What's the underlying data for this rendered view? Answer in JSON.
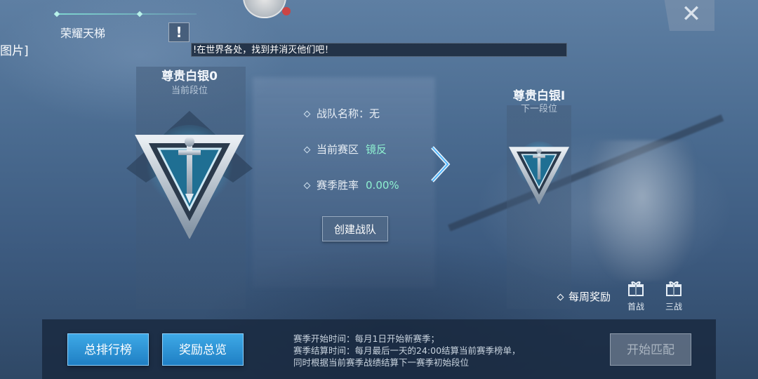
{
  "header": {
    "title": "荣耀天梯",
    "left_edge_text": "图片]",
    "banner_text": "!在世界各处，找到并消灭他们吧！"
  },
  "current_rank": {
    "name": "尊贵白银0",
    "caption": "当前段位"
  },
  "next_rank": {
    "name": "尊贵白银I",
    "caption": "下一段位"
  },
  "team_info": {
    "team_name_label": "战队名称：",
    "team_name_value": "无",
    "region_label": "当前赛区",
    "region_value": "镜反",
    "winrate_label": "赛季胜率",
    "winrate_value": "0.00%"
  },
  "create_team_label": "创建战队",
  "weekly_rewards": {
    "label": "每周奖励",
    "gifts": [
      {
        "label": "首战",
        "icon": "gift-icon"
      },
      {
        "label": "三战",
        "icon": "gift-icon"
      }
    ]
  },
  "bottom": {
    "leaderboard_label": "总排行榜",
    "rewards_overview_label": "奖励总览",
    "season_lines": [
      "赛季开始时间：每月1日开始新赛季；",
      "赛季结算时间：每月最后一天的24:00结算当前赛季榜单，",
      "同时根据当前赛季战绩结算下一赛季初始段位"
    ],
    "start_match_label": "开始匹配"
  },
  "colors": {
    "accent_value": "#8ef0d0",
    "button_blue": "#2a93d6"
  }
}
